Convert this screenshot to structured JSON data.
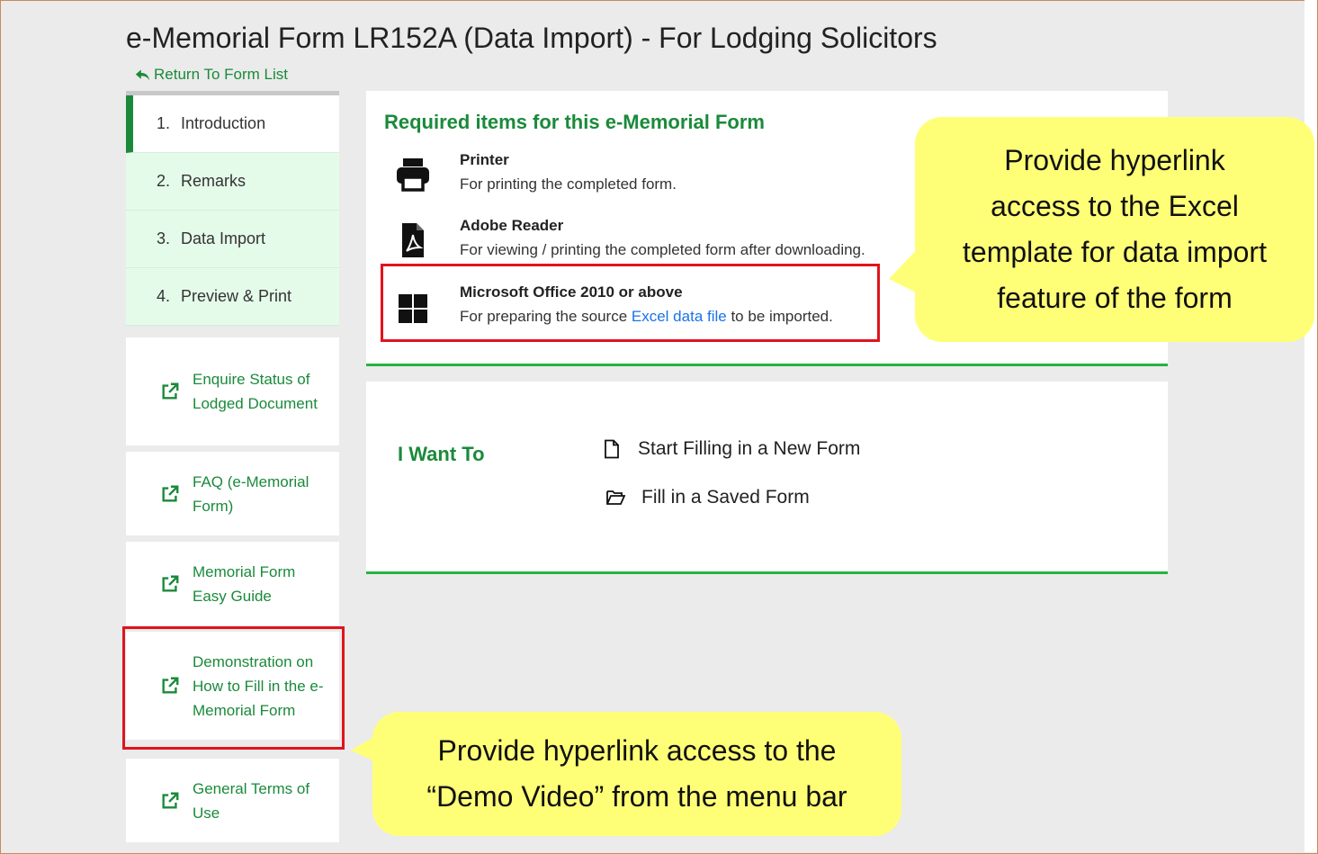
{
  "page": {
    "title": "e-Memorial Form LR152A (Data Import) - For Lodging Solicitors",
    "return_link": "Return To Form List"
  },
  "steps": [
    {
      "num": "1.",
      "label": "Introduction",
      "active": true
    },
    {
      "num": "2.",
      "label": "Remarks",
      "active": false
    },
    {
      "num": "3.",
      "label": "Data Import",
      "active": false
    },
    {
      "num": "4.",
      "label": "Preview & Print",
      "active": false
    }
  ],
  "side_links": [
    {
      "label": "Enquire Status of Lodged Document",
      "icon": "external-link-icon"
    },
    {
      "label": "FAQ (e-Memorial Form)",
      "icon": "external-link-icon"
    },
    {
      "label": "Memorial Form Easy Guide",
      "icon": "external-link-icon"
    },
    {
      "label": "Demonstration on How to Fill in the e-Memorial Form",
      "icon": "external-link-icon"
    },
    {
      "label": "General Terms of Use",
      "icon": "external-link-icon"
    }
  ],
  "required": {
    "heading": "Required items for this e-Memorial Form",
    "items": [
      {
        "name": "Printer",
        "desc": "For printing the completed form.",
        "icon": "printer-icon"
      },
      {
        "name": "Adobe Reader",
        "desc": "For viewing / printing the completed form after downloading.",
        "icon": "pdf-file-icon"
      },
      {
        "name": "Microsoft Office 2010 or above",
        "desc_prefix": "For preparing the source ",
        "desc_link": "Excel data file",
        "desc_suffix": " to be imported.",
        "icon": "windows-icon"
      }
    ]
  },
  "want": {
    "heading": "I Want To",
    "actions": [
      {
        "label": "Start Filling in a New Form",
        "icon": "file-icon"
      },
      {
        "label": "Fill in a Saved Form",
        "icon": "folder-open-icon"
      }
    ]
  },
  "callouts": {
    "top": [
      "Provide hyperlink",
      "access to the Excel",
      "template for data import",
      "feature of the form"
    ],
    "bottom": [
      "Provide hyperlink access to the",
      "“Demo Video” from the menu bar"
    ]
  },
  "colors": {
    "brand_green": "#1a8a3a",
    "accent_green": "#26b341",
    "link_blue": "#1a73e8",
    "highlight_red": "#e0141e",
    "callout_yellow": "#ffff77"
  }
}
